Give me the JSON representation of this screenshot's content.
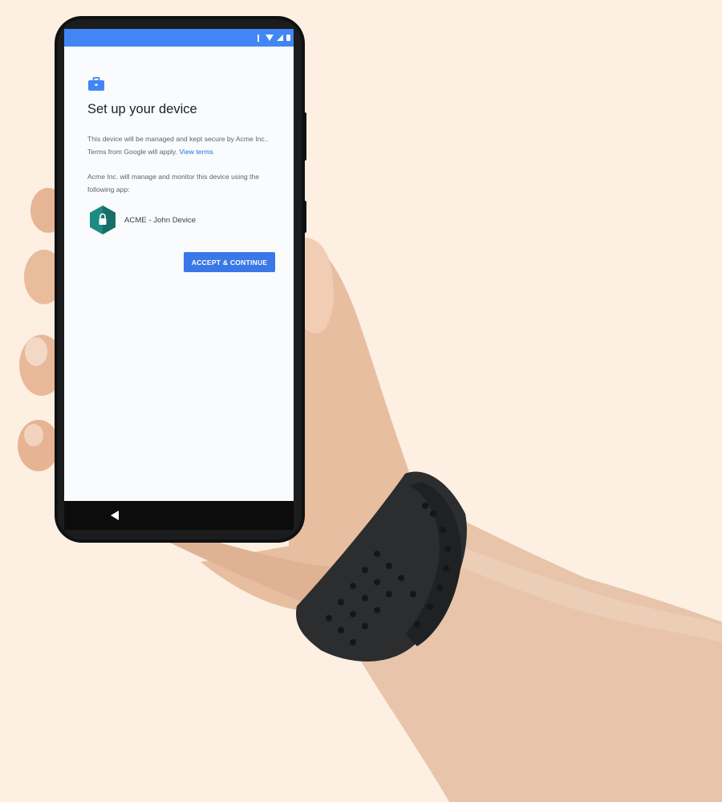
{
  "screen": {
    "title": "Set up your device",
    "paragraph1_text": "This device will be managed and kept secure by Acme Inc.. Terms from Google will apply.",
    "paragraph1_link": "View terms",
    "paragraph2_text": "Acme Inc. will manage and monitor this device using the following app:",
    "app_name": "ACME - John Device",
    "accept_label": "ACCEPT & CONTINUE"
  },
  "icons": {
    "header": "briefcase-icon",
    "app": "acme-app-icon",
    "nav": "back-icon",
    "status": [
      "bluetooth-icon",
      "wifi-icon",
      "signal-icon",
      "battery-icon"
    ]
  },
  "colors": {
    "background": "#fdefe2",
    "status_bar": "#4285f4",
    "accent_button": "#3b78e7",
    "link": "#1a73e8",
    "app_icon": "#1e8a84",
    "briefcase": "#4285f4",
    "wristband": "#2b2d2f"
  }
}
